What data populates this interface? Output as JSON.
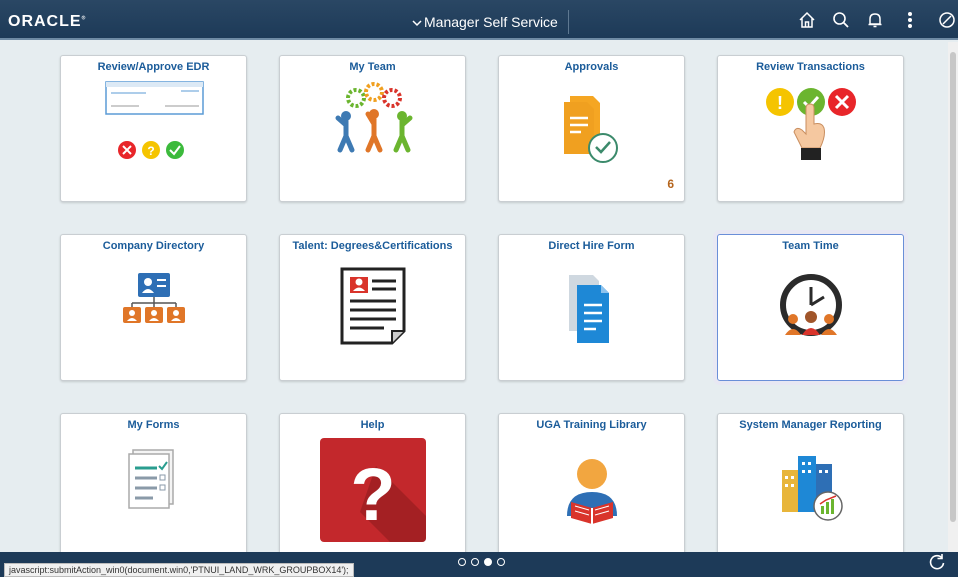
{
  "header": {
    "logo": "ORACLE",
    "homepage": "Manager Self Service",
    "icons": [
      "home-icon",
      "search-icon",
      "notification-icon",
      "actions-icon",
      "navbar-icon"
    ]
  },
  "tiles": [
    {
      "title": "Review/Approve EDR",
      "count": ""
    },
    {
      "title": "My Team",
      "count": ""
    },
    {
      "title": "Approvals",
      "count": "6"
    },
    {
      "title": "Review Transactions",
      "count": ""
    },
    {
      "title": "Company Directory",
      "count": ""
    },
    {
      "title": "Talent: Degrees&Certifications",
      "count": ""
    },
    {
      "title": "Direct Hire Form",
      "count": ""
    },
    {
      "title": "Team Time",
      "count": ""
    },
    {
      "title": "My Forms",
      "count": ""
    },
    {
      "title": "Help",
      "count": ""
    },
    {
      "title": "UGA Training Library",
      "count": ""
    },
    {
      "title": "System Manager Reporting",
      "count": ""
    }
  ],
  "pagination": {
    "pages": 4,
    "current": 3
  },
  "statusbar": {
    "text": "javascript:submitAction_win0(document.win0,'PTNUI_LAND_WRK_GROUPBOX14');"
  },
  "colors": {
    "header": "#1d3a58",
    "tile_title": "#1b5c9a",
    "count": "#b5651d",
    "background": "#e6edf0"
  }
}
